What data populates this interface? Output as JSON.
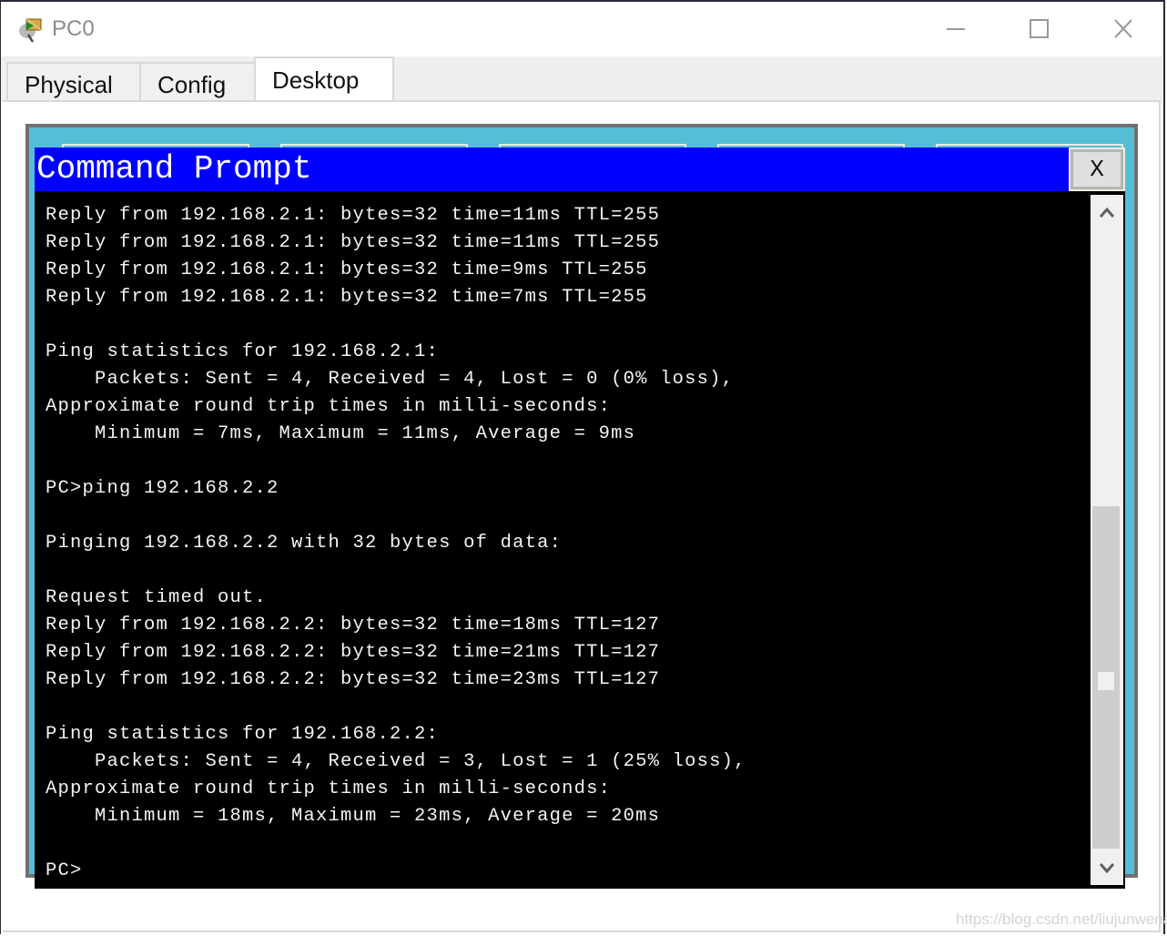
{
  "window": {
    "title": "PC0",
    "icon": "pc-device-icon",
    "controls": {
      "minimize": "minimize-icon",
      "maximize": "maximize-icon",
      "close": "close-icon"
    }
  },
  "tabs": [
    {
      "label": "Physical",
      "active": false
    },
    {
      "label": "Config",
      "active": false
    },
    {
      "label": "Desktop",
      "active": true
    }
  ],
  "cmd": {
    "title": "Command Prompt",
    "close_label": "X",
    "lines": [
      "Reply from 192.168.2.1: bytes=32 time=11ms TTL=255",
      "Reply from 192.168.2.1: bytes=32 time=11ms TTL=255",
      "Reply from 192.168.2.1: bytes=32 time=9ms TTL=255",
      "Reply from 192.168.2.1: bytes=32 time=7ms TTL=255",
      "",
      "Ping statistics for 192.168.2.1:",
      "    Packets: Sent = 4, Received = 4, Lost = 0 (0% loss),",
      "Approximate round trip times in milli-seconds:",
      "    Minimum = 7ms, Maximum = 11ms, Average = 9ms",
      "",
      "PC>ping 192.168.2.2",
      "",
      "Pinging 192.168.2.2 with 32 bytes of data:",
      "",
      "Request timed out.",
      "Reply from 192.168.2.2: bytes=32 time=18ms TTL=127",
      "Reply from 192.168.2.2: bytes=32 time=21ms TTL=127",
      "Reply from 192.168.2.2: bytes=32 time=23ms TTL=127",
      "",
      "Ping statistics for 192.168.2.2:",
      "    Packets: Sent = 4, Received = 3, Lost = 1 (25% loss),",
      "Approximate round trip times in milli-seconds:",
      "    Minimum = 18ms, Maximum = 23ms, Average = 20ms",
      "",
      "PC>"
    ],
    "scroll_position": 1.0
  },
  "colors": {
    "cmd_titlebar": "#0000ff",
    "desktop_bg": "#55bed6",
    "terminal_bg": "#000000",
    "terminal_fg": "#f4f4f4"
  },
  "watermark": "https://blog.csdn.net/liujunwena"
}
